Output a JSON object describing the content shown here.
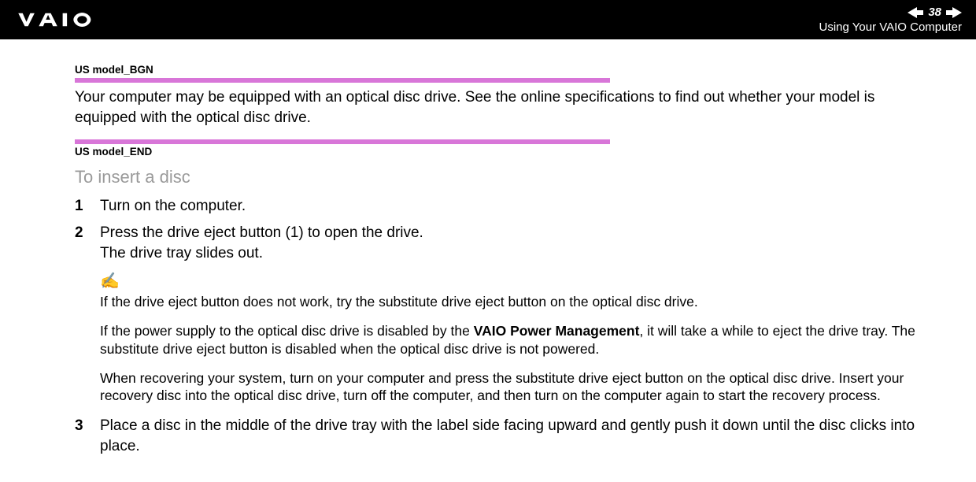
{
  "header": {
    "page_number": "38",
    "section": "Using Your VAIO Computer"
  },
  "tags": {
    "begin": "US model_BGN",
    "end": "US model_END"
  },
  "intro": "Your computer may be equipped with an optical disc drive. See the online specifications to find out whether your model is equipped with the optical disc drive.",
  "subheading": "To insert a disc",
  "steps": {
    "s1": {
      "num": "1",
      "text": "Turn on the computer."
    },
    "s2": {
      "num": "2",
      "line1": "Press the drive eject button (1) to open the drive.",
      "line2": "The drive tray slides out."
    },
    "s3": {
      "num": "3",
      "text": "Place a disc in the middle of the drive tray with the label side facing upward and gently push it down until the disc clicks into place."
    }
  },
  "note": {
    "icon": "✍",
    "p1": "If the drive eject button does not work, try the substitute drive eject button on the optical disc drive.",
    "p2_a": "If the power supply to the optical disc drive is disabled by the ",
    "p2_bold": "VAIO Power Management",
    "p2_b": ", it will take a while to eject the drive tray. The substitute drive eject button is disabled when the optical disc drive is not powered.",
    "p3": "When recovering your system, turn on your computer and press the substitute drive eject button on the optical disc drive. Insert your recovery disc into the optical disc drive, turn off the computer, and then turn on the computer again to start the recovery process."
  }
}
